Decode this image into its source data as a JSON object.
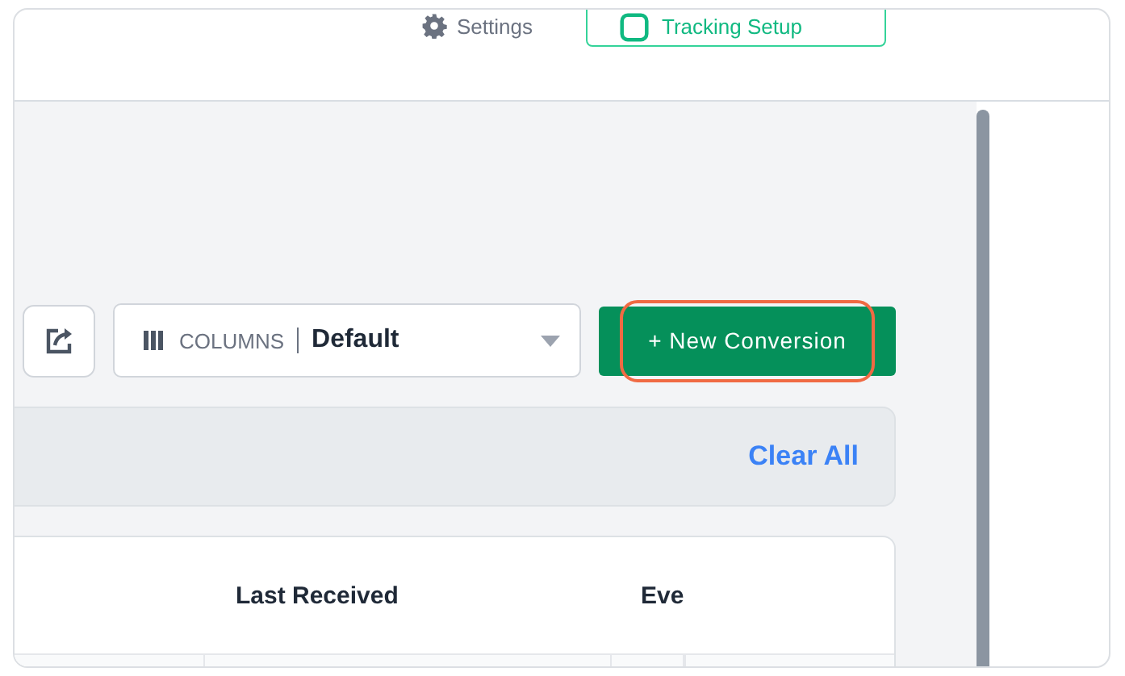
{
  "header": {
    "settings_link": "Settings",
    "tracking_button": "Tracking Setup"
  },
  "toolbar": {
    "columns_label": "COLUMNS",
    "columns_value": "Default",
    "new_button": "+ New Conversion",
    "new_button_highlighted": true
  },
  "filters": {
    "clear_all": "Clear All"
  },
  "table": {
    "columns": [
      "Last Received",
      "Eve"
    ]
  }
}
